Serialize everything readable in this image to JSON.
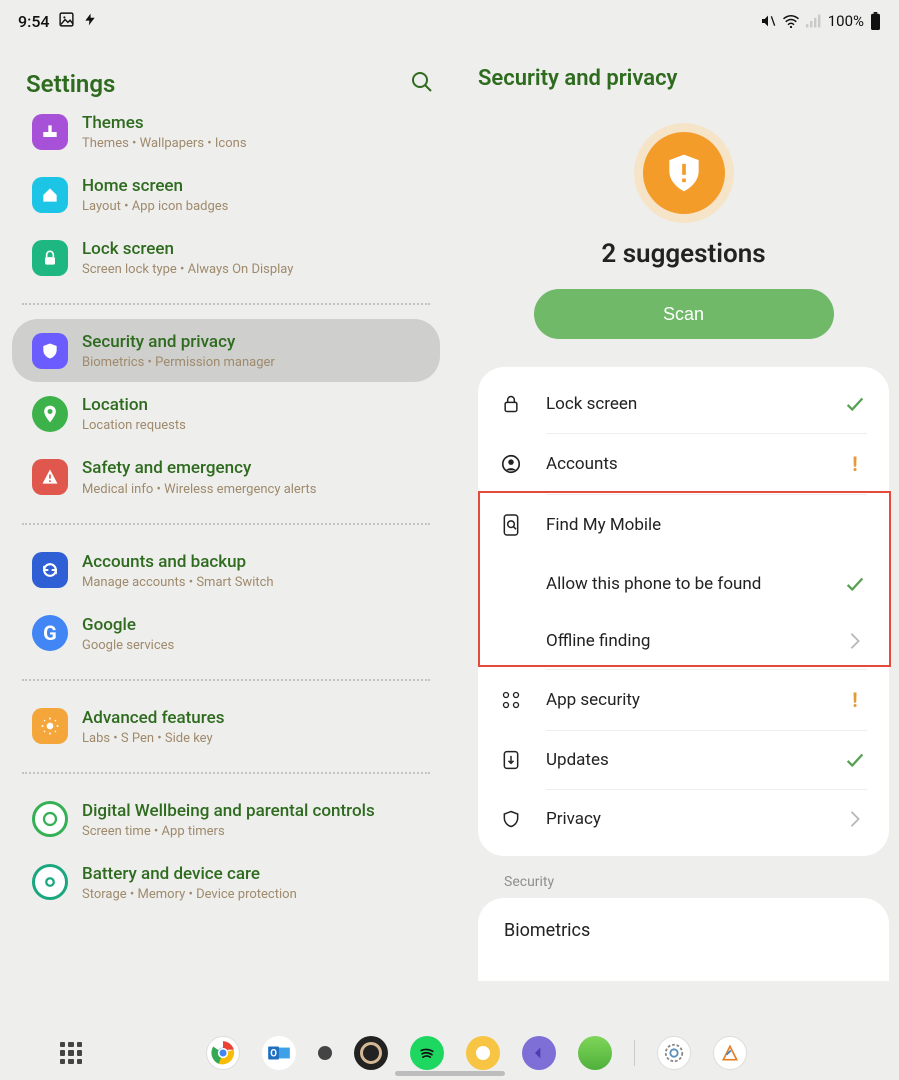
{
  "status": {
    "time": "9:54",
    "battery": "100%"
  },
  "left": {
    "title": "Settings",
    "items": [
      {
        "title": "Themes",
        "sub": "Themes  •  Wallpapers  •  Icons"
      },
      {
        "title": "Home screen",
        "sub": "Layout  •  App icon badges"
      },
      {
        "title": "Lock screen",
        "sub": "Screen lock type  •  Always On Display"
      },
      {
        "title": "Security and privacy",
        "sub": "Biometrics  •  Permission manager"
      },
      {
        "title": "Location",
        "sub": "Location requests"
      },
      {
        "title": "Safety and emergency",
        "sub": "Medical info  •  Wireless emergency alerts"
      },
      {
        "title": "Accounts and backup",
        "sub": "Manage accounts  •  Smart Switch"
      },
      {
        "title": "Google",
        "sub": "Google services"
      },
      {
        "title": "Advanced features",
        "sub": "Labs  •  S Pen  •  Side key"
      },
      {
        "title": "Digital Wellbeing and parental controls",
        "sub": "Screen time  •  App timers"
      },
      {
        "title": "Battery and device care",
        "sub": "Storage  •  Memory  •  Device protection"
      }
    ]
  },
  "right": {
    "title": "Security and privacy",
    "suggestions": "2 suggestions",
    "scan": "Scan",
    "rows": {
      "lock": "Lock screen",
      "accounts": "Accounts",
      "find": "Find My Mobile",
      "allow": "Allow this phone to be found",
      "offline": "Offline finding",
      "appsec": "App security",
      "updates": "Updates",
      "privacy": "Privacy"
    },
    "sectionSecurity": "Security",
    "biometrics": "Biometrics"
  }
}
